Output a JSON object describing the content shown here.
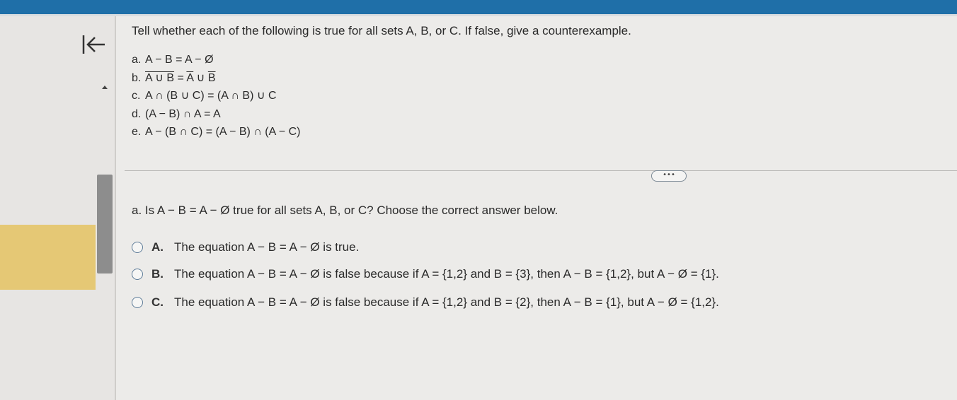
{
  "header": {
    "accent_color": "#1f6fa8"
  },
  "nav": {
    "back_icon": "skip-to-start-icon",
    "scroll_up_icon": "triangle-up-icon"
  },
  "problem": {
    "prompt": "Tell whether each of the following is true for all sets A, B, or C. If false, give a counterexample.",
    "parts": [
      {
        "label": "a.",
        "text": "A − B = A − Ø"
      },
      {
        "label": "b.",
        "lhs": "A ∪ B",
        "eq": " = ",
        "rhs_a": "A",
        "union": " ∪ ",
        "rhs_b": "B"
      },
      {
        "label": "c.",
        "text": "A ∩ (B ∪ C) = (A ∩ B) ∪ C"
      },
      {
        "label": "d.",
        "text": "(A − B) ∩ A = A"
      },
      {
        "label": "e.",
        "text": "A − (B ∩ C) = (A − B) ∩ (A − C)"
      }
    ]
  },
  "expand_button": {
    "label": "•••"
  },
  "question": {
    "text": "a. Is A − B = A − Ø true for all sets A, B, or C? Choose the correct answer below.",
    "options": [
      {
        "letter": "A.",
        "text": "The equation A − B = A − Ø is true."
      },
      {
        "letter": "B.",
        "text": "The equation A − B = A − Ø is false because if A = {1,2} and B = {3}, then A − B = {1,2}, but A − Ø = {1}."
      },
      {
        "letter": "C.",
        "text": "The equation A − B = A − Ø is false because if A = {1,2} and B = {2}, then A − B = {1}, but A − Ø = {1,2}."
      }
    ]
  }
}
